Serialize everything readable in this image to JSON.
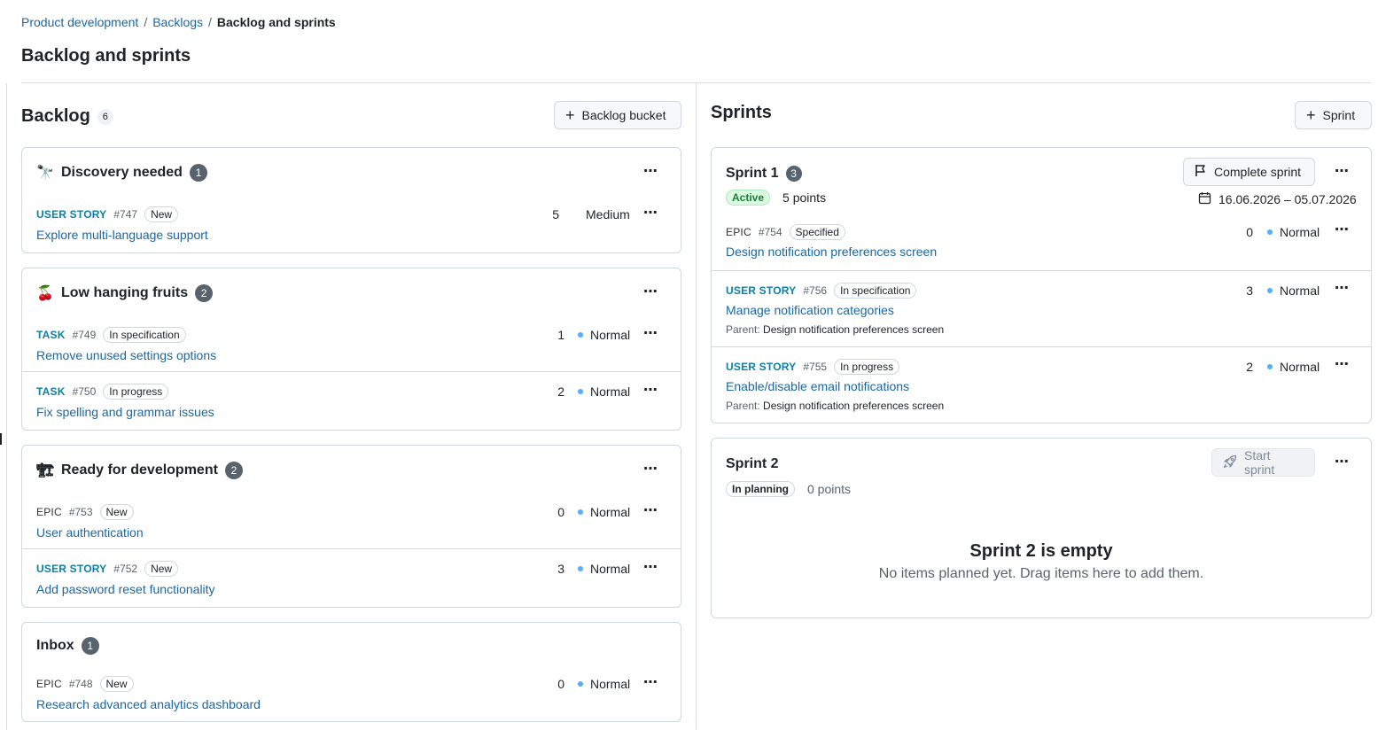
{
  "breadcrumb": {
    "items": [
      "Product development",
      "Backlogs"
    ],
    "current": "Backlog and sprints",
    "separator": "/"
  },
  "page": {
    "title": "Backlog and sprints"
  },
  "backlog": {
    "title": "Backlog",
    "count": "6",
    "add_button": "Backlog bucket",
    "buckets": [
      {
        "emoji": "🔭",
        "name": "Discovery needed",
        "count": "1",
        "items": [
          {
            "type": "USER STORY",
            "id": "#747",
            "status": "New",
            "title": "Explore multi-language support",
            "points": "5",
            "priority": "Medium"
          }
        ]
      },
      {
        "emoji": "🍒",
        "name": "Low hanging fruits",
        "count": "2",
        "items": [
          {
            "type": "TASK",
            "id": "#749",
            "status": "In specification",
            "title": "Remove unused settings options",
            "points": "1",
            "priority": "Normal"
          },
          {
            "type": "TASK",
            "id": "#750",
            "status": "In progress",
            "title": "Fix spelling and grammar issues",
            "points": "2",
            "priority": "Normal"
          }
        ]
      },
      {
        "emoji": "🏗",
        "name": "Ready for development",
        "count": "2",
        "items": [
          {
            "type": "EPIC",
            "id": "#753",
            "status": "New",
            "title": "User authentication",
            "points": "0",
            "priority": "Normal"
          },
          {
            "type": "USER STORY",
            "id": "#752",
            "status": "New",
            "title": "Add password reset functionality",
            "points": "3",
            "priority": "Normal"
          }
        ]
      },
      {
        "emoji": "",
        "name": "Inbox",
        "count": "1",
        "items": [
          {
            "type": "EPIC",
            "id": "#748",
            "status": "New",
            "title": "Research advanced analytics dashboard",
            "points": "0",
            "priority": "Normal"
          }
        ]
      }
    ]
  },
  "sprints": {
    "title": "Sprints",
    "add_button": "Sprint",
    "list": [
      {
        "name": "Sprint 1",
        "count": "3",
        "state": "Active",
        "points": "5 points",
        "action": "Complete sprint",
        "dates": "16.06.2026 – 05.07.2026",
        "items": [
          {
            "type": "EPIC",
            "id": "#754",
            "status": "Specified",
            "title": "Design notification preferences screen",
            "points": "0",
            "priority": "Normal",
            "parent_label": "",
            "parent": ""
          },
          {
            "type": "USER STORY",
            "id": "#756",
            "status": "In specification",
            "title": "Manage notification categories",
            "points": "3",
            "priority": "Normal",
            "parent_label": "Parent:",
            "parent": "Design notification preferences screen"
          },
          {
            "type": "USER STORY",
            "id": "#755",
            "status": "In progress",
            "title": "Enable/disable email notifications",
            "points": "2",
            "priority": "Normal",
            "parent_label": "Parent:",
            "parent": "Design notification preferences screen"
          }
        ]
      },
      {
        "name": "Sprint 2",
        "state": "In planning",
        "points": "0 points",
        "action": "Start sprint",
        "empty_title": "Sprint 2 is empty",
        "empty_desc": "No items planned yet. Drag items here to add them."
      }
    ]
  },
  "colors": {
    "link": "#1a67a3",
    "story_type": "#0b80a8",
    "priority_dot": "#54aeff",
    "active_badge": "#1a7f37"
  },
  "icons": {
    "more": "⋯",
    "plus": "+",
    "flag": "flag-icon",
    "calendar": "calendar-icon",
    "rocket": "rocket-icon"
  }
}
